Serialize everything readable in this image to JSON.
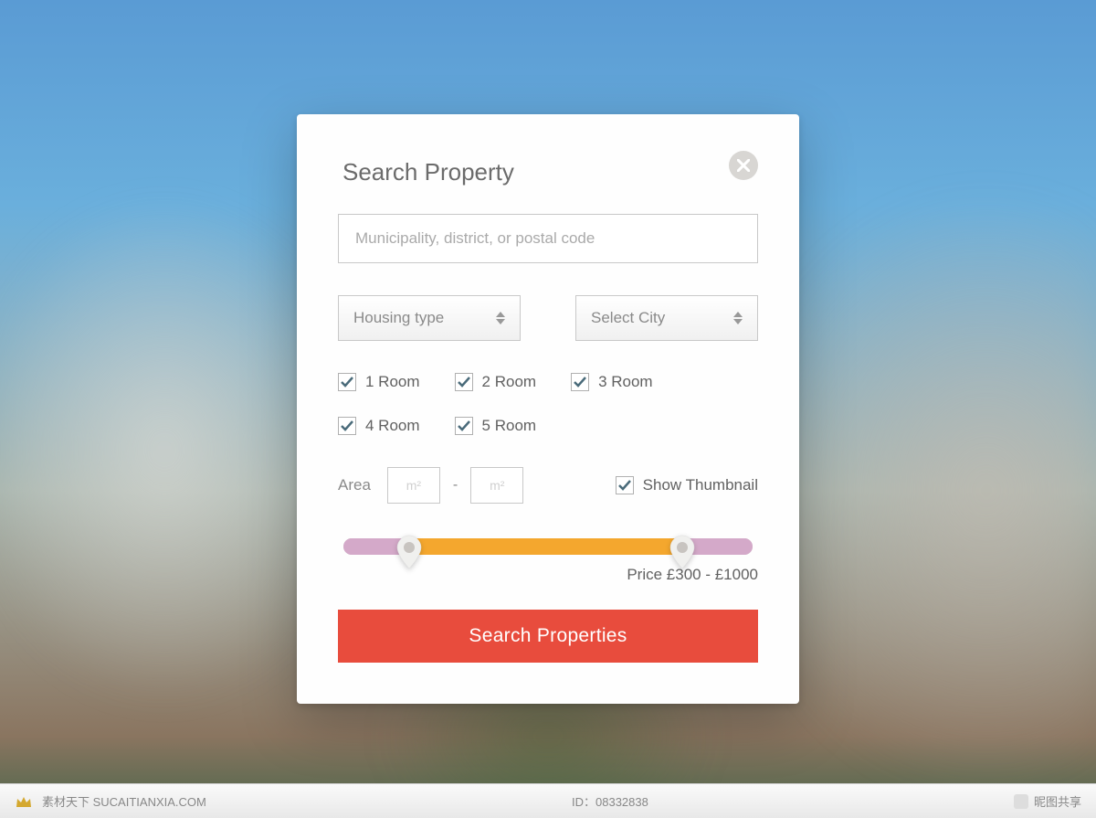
{
  "modal": {
    "title": "Search Property",
    "search_placeholder": "Municipality, district, or postal code",
    "dropdowns": {
      "housing_type": "Housing type",
      "select_city": "Select City"
    },
    "rooms": {
      "r1": "1 Room",
      "r2": "2 Room",
      "r3": "3 Room",
      "r4": "4 Room",
      "r5": "5 Room"
    },
    "area": {
      "label": "Area",
      "placeholder_min": "m²",
      "placeholder_max": "m²",
      "dash": "-"
    },
    "thumbnail_label": "Show Thumbnail",
    "price_label": "Price £300 - £1000",
    "submit_label": "Search Properties"
  },
  "footer": {
    "brand": "素材天下 SUCAITIANXIA.COM",
    "id_label": "ID：08332838",
    "tag_label": "昵图共享"
  }
}
